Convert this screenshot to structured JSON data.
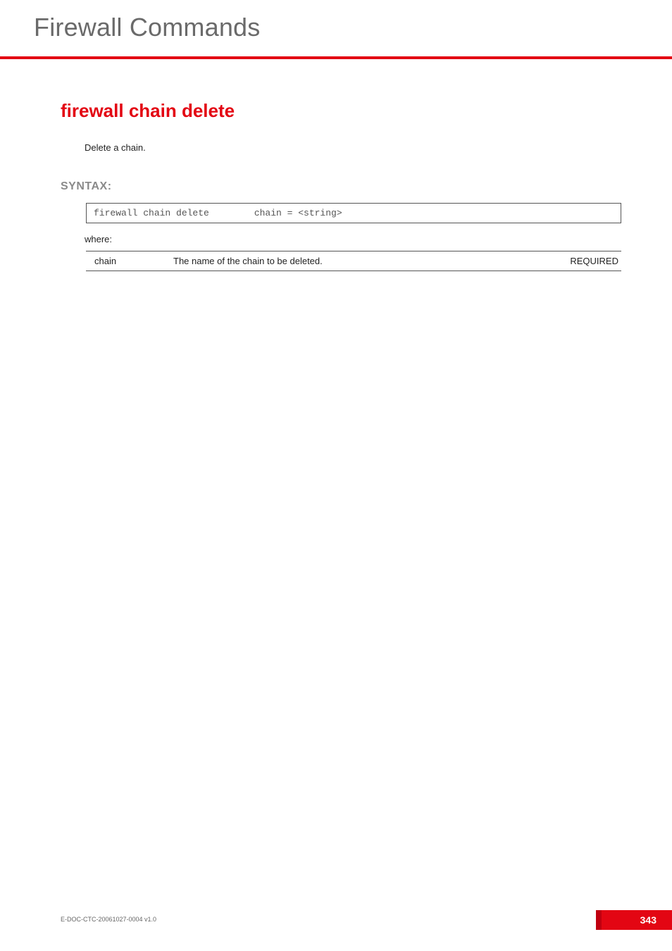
{
  "chapter_title": "Firewall Commands",
  "command_title": "firewall chain delete",
  "description": "Delete a chain.",
  "syntax_label": "SYNTAX:",
  "syntax": {
    "command": "firewall chain delete",
    "args": "chain = <string>"
  },
  "where_label": "where:",
  "params": [
    {
      "name": "chain",
      "desc": "The name of the chain to be deleted.",
      "req": "REQUIRED"
    }
  ],
  "footer": {
    "doc_id": "E-DOC-CTC-20061027-0004 v1.0",
    "page_number": "343"
  }
}
